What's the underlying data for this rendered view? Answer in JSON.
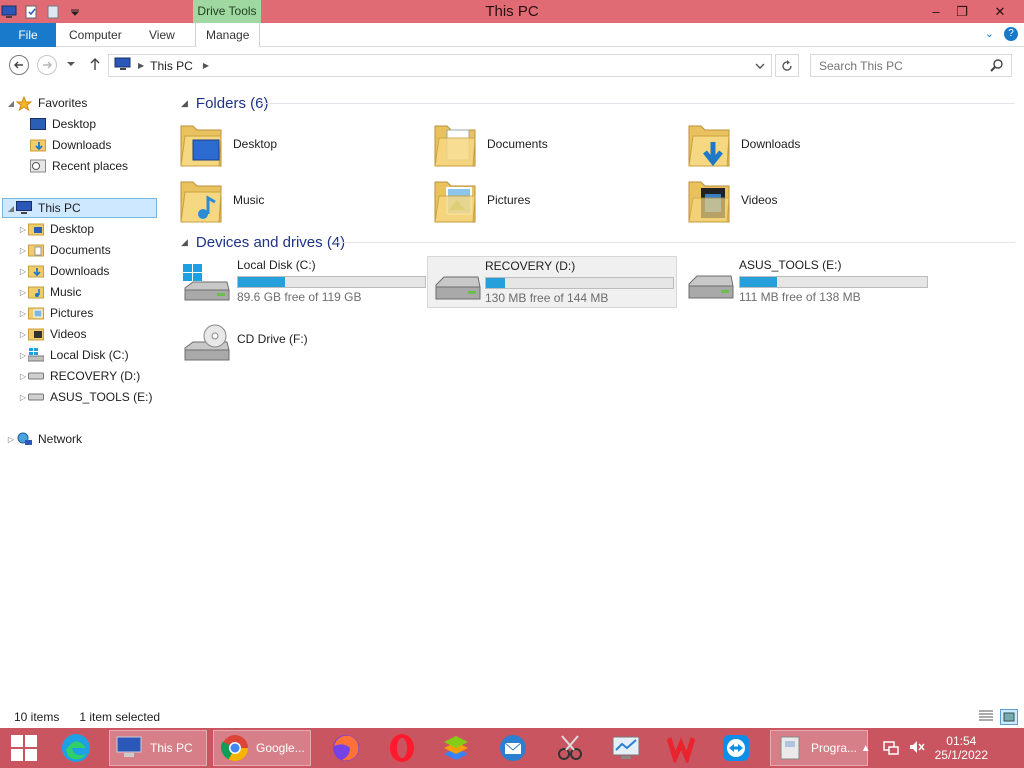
{
  "window": {
    "title": "This PC",
    "contextual_tab": "Drive Tools",
    "minimize": "–",
    "restore": "❐",
    "close": "✕"
  },
  "ribbon": {
    "tabs": [
      "File",
      "Computer",
      "View",
      "Manage"
    ],
    "help_glyph": "?",
    "expand_glyph": "⌄"
  },
  "address": {
    "breadcrumb": "This PC",
    "search_placeholder": "Search This PC"
  },
  "nav": {
    "favorites": "Favorites",
    "favorites_items": [
      "Desktop",
      "Downloads",
      "Recent places"
    ],
    "this_pc": "This PC",
    "this_pc_items": [
      "Desktop",
      "Documents",
      "Downloads",
      "Music",
      "Pictures",
      "Videos",
      "Local Disk (C:)",
      "RECOVERY (D:)",
      "ASUS_TOOLS (E:)"
    ],
    "network": "Network"
  },
  "folders": {
    "header": "Folders (6)",
    "items": [
      "Desktop",
      "Documents",
      "Downloads",
      "Music",
      "Pictures",
      "Videos"
    ]
  },
  "drives": {
    "header": "Devices and drives (4)",
    "items": [
      {
        "name": "Local Disk (C:)",
        "free": "89.6 GB free of 119 GB",
        "used_fraction": 0.25
      },
      {
        "name": "RECOVERY (D:)",
        "free": "130 MB free of 144 MB",
        "used_fraction": 0.1
      },
      {
        "name": "ASUS_TOOLS (E:)",
        "free": "111 MB free of 138 MB",
        "used_fraction": 0.2
      },
      {
        "name": "CD Drive (F:)"
      }
    ]
  },
  "status": {
    "items": "10 items",
    "selected": "1 item selected"
  },
  "taskbar": {
    "apps": [
      {
        "label": "This PC"
      },
      {
        "label": "Google..."
      },
      {
        "label": "Progra..."
      }
    ],
    "time": "01:54",
    "date": "25/1/2022"
  },
  "colors": {
    "titlebar": "#e06b74",
    "taskbar": "#c95560",
    "accent": "#1979ca",
    "drive_fill": "#26a0da"
  }
}
